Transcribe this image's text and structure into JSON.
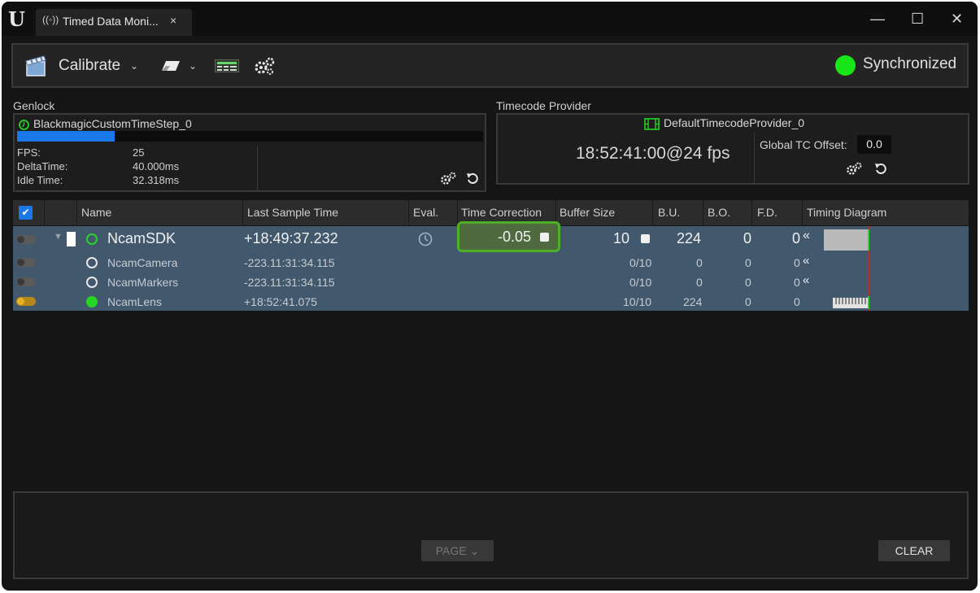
{
  "window": {
    "tab_title": "Timed Data Moni...",
    "tab_close": "×",
    "minimize": "—",
    "maximize": "☐",
    "close": "✕"
  },
  "toolbar": {
    "calibrate_label": "Calibrate",
    "chevron": "⌄",
    "sync_status": "Synchronized",
    "sync_color": "#19e619"
  },
  "genlock": {
    "section_label": "Genlock",
    "name": "BlackmagicCustomTimeStep_0",
    "progress": 0.21,
    "fps_label": "FPS:",
    "fps_value": "25",
    "delta_label": "DeltaTime:",
    "delta_value": "40.000ms",
    "idle_label": "Idle Time:",
    "idle_value": "32.318ms"
  },
  "timecode": {
    "section_label": "Timecode Provider",
    "provider_name": "DefaultTimecodeProvider_0",
    "value": "18:52:41:00@24 fps",
    "offset_label": "Global TC Offset:",
    "offset_value": "0.0"
  },
  "table": {
    "headers": {
      "name": "Name",
      "last_sample_time": "Last Sample Time",
      "eval": "Eval.",
      "time_correction": "Time Correction",
      "buffer_size": "Buffer Size",
      "bu": "B.U.",
      "bo": "B.O.",
      "fd": "F.D.",
      "timing_diagram": "Timing Diagram"
    },
    "parent": {
      "name": "NcamSDK",
      "last_sample_time": "+18:49:37.232",
      "time_correction": "-0.05",
      "buffer_size": "10",
      "bu": "224",
      "bo": "0",
      "fd": "0",
      "rewind": "«"
    },
    "children": [
      {
        "name": "NcamCamera",
        "last_sample_time": "-223.11:31:34.115",
        "buffer": "0/10",
        "bu": "0",
        "bo": "0",
        "fd": "0",
        "rewind": "«"
      },
      {
        "name": "NcamMarkers",
        "last_sample_time": "-223.11:31:34.115",
        "buffer": "0/10",
        "bu": "0",
        "bo": "0",
        "fd": "0",
        "rewind": "«"
      },
      {
        "name": "NcamLens",
        "last_sample_time": "+18:52:41.075",
        "buffer": "10/10",
        "bu": "224",
        "bo": "0",
        "fd": "0"
      }
    ]
  },
  "log": {
    "page_label": "PAGE ⌄",
    "clear_label": "CLEAR"
  }
}
